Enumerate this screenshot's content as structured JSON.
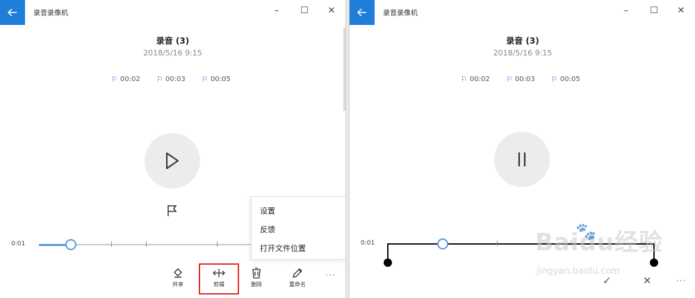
{
  "left": {
    "app_title": "录音录像机",
    "recording_title": "录音 (3)",
    "recording_date": "2018/5/16 9:15",
    "markers": [
      "00:02",
      "00:03",
      "00:05"
    ],
    "elapsed": "0:01",
    "playback_progress": 0.15,
    "context_menu": {
      "items": [
        "设置",
        "反馈",
        "打开文件位置"
      ]
    },
    "toolbar": {
      "share": "共享",
      "trim": "剪辑",
      "delete": "删除",
      "rename": "重命名",
      "more": "···"
    }
  },
  "right": {
    "app_title": "录音录像机",
    "recording_title": "录音 (3)",
    "recording_date": "2018/5/16 9:15",
    "markers": [
      "00:02",
      "00:03",
      "00:05"
    ],
    "elapsed": "0:01",
    "more": "···"
  },
  "watermark": {
    "main": "Baidu经验",
    "sub": "jingyan.baidu.com"
  },
  "colors": {
    "accent": "#1f7fd8",
    "highlight": "#e0302a"
  }
}
